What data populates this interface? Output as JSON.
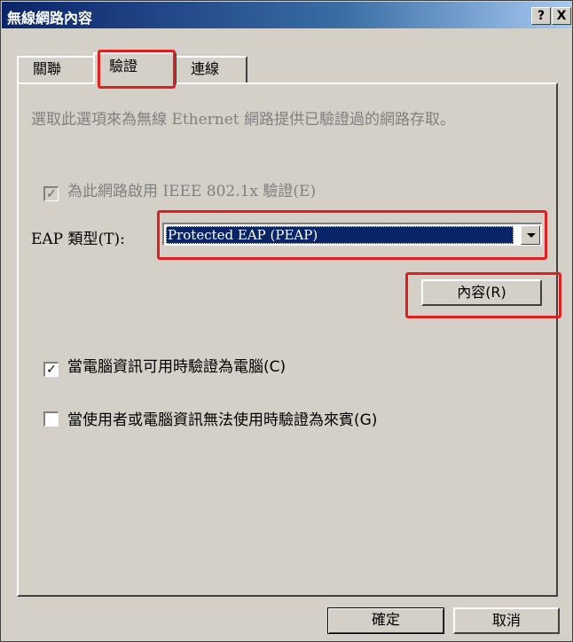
{
  "window": {
    "title": "無線網路內容",
    "help_label": "?",
    "close_label": "X"
  },
  "tabs": [
    {
      "label": "關聯"
    },
    {
      "label": "驗證"
    },
    {
      "label": "連線"
    }
  ],
  "auth": {
    "description": "選取此選項來為無線 Ethernet 網路提供已驗證過的網路存取。",
    "enable_8021x_label": "為此網路啟用 IEEE 802.1x 驗證(E)",
    "enable_8021x_checked": true,
    "eap_type_label": "EAP 類型(T):",
    "eap_type_value": "Protected EAP (PEAP)",
    "properties_button": "內容(R)",
    "computer_auth_label": "當電腦資訊可用時驗證為電腦(C)",
    "computer_auth_checked": true,
    "guest_auth_label": "當使用者或電腦資訊無法使用時驗證為來賓(G)",
    "guest_auth_checked": false
  },
  "footer": {
    "ok_label": "確定",
    "cancel_label": "取消"
  },
  "checkmark_glyph": "✓",
  "highlight_color": "#e02020"
}
